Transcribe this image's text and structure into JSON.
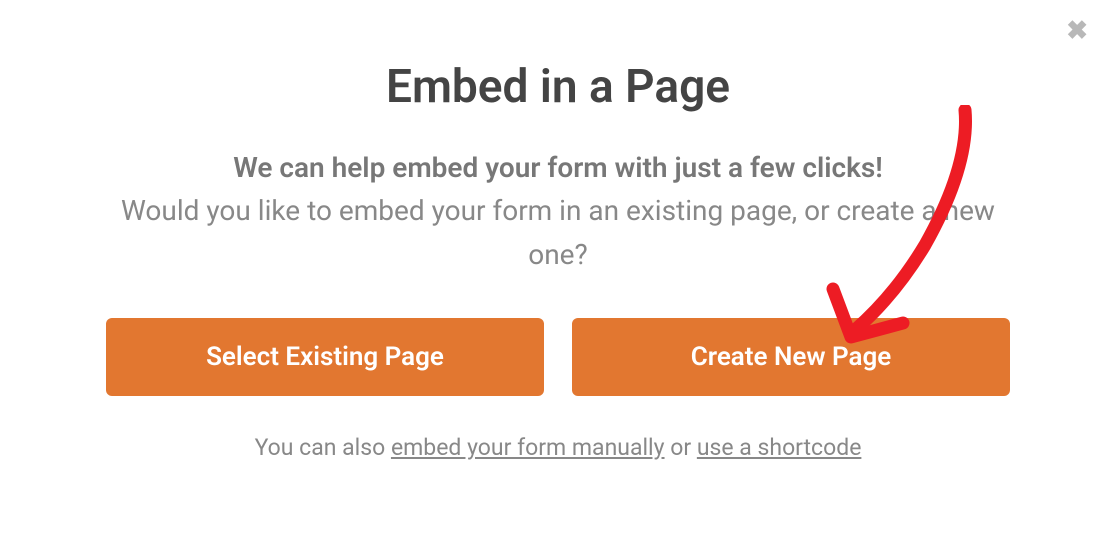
{
  "modal": {
    "title": "Embed in a Page",
    "subtitle_lead": "We can help embed your form with just a few clicks!",
    "subtitle_body": "Would you like to embed your form in an existing page, or create a new one?",
    "buttons": {
      "select_existing": "Select Existing Page",
      "create_new": "Create New Page"
    },
    "footer": {
      "prefix": "You can also ",
      "link_manual": "embed your form manually",
      "middle": " or ",
      "link_shortcode": "use a shortcode"
    }
  }
}
